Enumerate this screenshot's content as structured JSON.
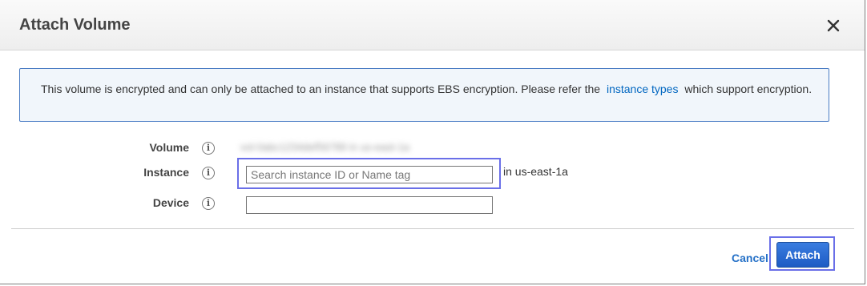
{
  "dialog": {
    "title": "Attach Volume"
  },
  "notice": {
    "text_before": "This volume is encrypted and can only be attached to an instance that supports EBS encryption. Please refer the",
    "link": "instance types",
    "text_after": "which support encryption."
  },
  "form": {
    "volume": {
      "label": "Volume",
      "value": "vol-0abc1234def56789 in us-east-1a"
    },
    "instance": {
      "label": "Instance",
      "placeholder": "Search instance ID or Name tag",
      "value": "",
      "region_suffix": "in us-east-1a"
    },
    "device": {
      "label": "Device",
      "value": ""
    },
    "info_icon_glyph": "i"
  },
  "footer": {
    "cancel_label": "Cancel",
    "attach_label": "Attach"
  },
  "icons": {
    "close": "close-icon",
    "info": "info-icon"
  },
  "colors": {
    "primary_button": "#1d5bc4",
    "link": "#0066c0",
    "notice_border": "#4a7cc4",
    "focus_outline": "#6a6fe8"
  }
}
